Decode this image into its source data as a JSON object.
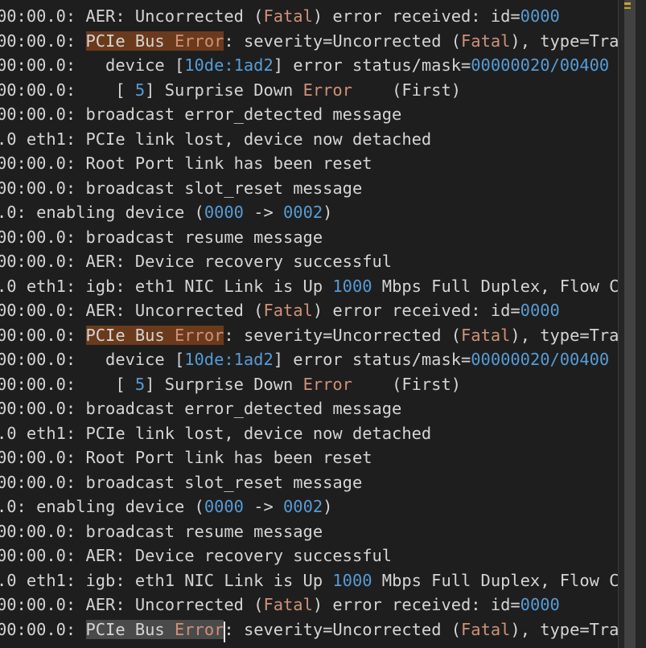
{
  "colors": {
    "background": "#1e1e1e",
    "text": "#d4d4d4",
    "number": "#569cd6",
    "error_word": "#ce9178",
    "search_highlight": "#6b3a1c",
    "current_match_highlight": "#4a4a4a",
    "overview_ruler_mark": "#c9a227"
  },
  "editor": {
    "lines": [
      [
        {
          "t": "00:00.0: AER: Uncorrected ("
        },
        {
          "t": "Fatal",
          "c": "err"
        },
        {
          "t": ") error received: id="
        },
        {
          "t": "0000",
          "c": "num"
        }
      ],
      [
        {
          "t": "00:00.0: "
        },
        {
          "t": "PCIe Bus ",
          "c": "hl"
        },
        {
          "t": "Error",
          "c": "err hl"
        },
        {
          "t": ": severity=Uncorrected ("
        },
        {
          "t": "Fatal",
          "c": "err"
        },
        {
          "t": "), type=Tra"
        }
      ],
      [
        {
          "t": "00:00.0:   device ["
        },
        {
          "t": "10de:1ad2",
          "c": "num"
        },
        {
          "t": "] error status/mask="
        },
        {
          "t": "00000020/00400",
          "c": "num"
        }
      ],
      [
        {
          "t": "00:00.0:    [ "
        },
        {
          "t": "5",
          "c": "num"
        },
        {
          "t": "] Surprise Down "
        },
        {
          "t": "Error",
          "c": "err"
        },
        {
          "t": "    (First)"
        }
      ],
      [
        {
          "t": "00:00.0: broadcast error_detected message"
        }
      ],
      [
        {
          "t": ".0 eth1: PCIe link lost, device now detached"
        }
      ],
      [
        {
          "t": "00:00.0: Root Port link has been reset"
        }
      ],
      [
        {
          "t": "00:00.0: broadcast slot_reset message"
        }
      ],
      [
        {
          "t": ".0: enabling device ("
        },
        {
          "t": "0000",
          "c": "num"
        },
        {
          "t": " -> "
        },
        {
          "t": "0002",
          "c": "num"
        },
        {
          "t": ")"
        }
      ],
      [
        {
          "t": "00:00.0: broadcast resume message"
        }
      ],
      [
        {
          "t": "00:00.0: AER: Device recovery successful"
        }
      ],
      [
        {
          "t": ".0 eth1: igb: eth1 NIC Link is Up "
        },
        {
          "t": "1000",
          "c": "num"
        },
        {
          "t": " Mbps Full Duplex, Flow C"
        }
      ],
      [
        {
          "t": "00:00.0: AER: Uncorrected ("
        },
        {
          "t": "Fatal",
          "c": "err"
        },
        {
          "t": ") error received: id="
        },
        {
          "t": "0000",
          "c": "num"
        }
      ],
      [
        {
          "t": "00:00.0: "
        },
        {
          "t": "PCIe Bus ",
          "c": "hl"
        },
        {
          "t": "Error",
          "c": "err hl"
        },
        {
          "t": ": severity=Uncorrected ("
        },
        {
          "t": "Fatal",
          "c": "err"
        },
        {
          "t": "), type=Tra"
        }
      ],
      [
        {
          "t": "00:00.0:   device ["
        },
        {
          "t": "10de:1ad2",
          "c": "num"
        },
        {
          "t": "] error status/mask="
        },
        {
          "t": "00000020/00400",
          "c": "num"
        }
      ],
      [
        {
          "t": "00:00.0:    [ "
        },
        {
          "t": "5",
          "c": "num"
        },
        {
          "t": "] Surprise Down "
        },
        {
          "t": "Error",
          "c": "err"
        },
        {
          "t": "    (First)"
        }
      ],
      [
        {
          "t": "00:00.0: broadcast error_detected message"
        }
      ],
      [
        {
          "t": ".0 eth1: PCIe link lost, device now detached"
        }
      ],
      [
        {
          "t": "00:00.0: Root Port link has been reset"
        }
      ],
      [
        {
          "t": "00:00.0: broadcast slot_reset message"
        }
      ],
      [
        {
          "t": ".0: enabling device ("
        },
        {
          "t": "0000",
          "c": "num"
        },
        {
          "t": " -> "
        },
        {
          "t": "0002",
          "c": "num"
        },
        {
          "t": ")"
        }
      ],
      [
        {
          "t": "00:00.0: broadcast resume message"
        }
      ],
      [
        {
          "t": "00:00.0: AER: Device recovery successful"
        }
      ],
      [
        {
          "t": ".0 eth1: igb: eth1 NIC Link is Up "
        },
        {
          "t": "1000",
          "c": "num"
        },
        {
          "t": " Mbps Full Duplex, Flow C"
        }
      ],
      [
        {
          "t": "00:00.0: AER: Uncorrected ("
        },
        {
          "t": "Fatal",
          "c": "err"
        },
        {
          "t": ") error received: id="
        },
        {
          "t": "0000",
          "c": "num"
        }
      ],
      [
        {
          "t": "00:00.0: "
        },
        {
          "t": "PCIe Bus ",
          "c": "hl cur"
        },
        {
          "t": "Error",
          "c": "err hl cur"
        },
        {
          "t": ": severity=Uncorrected ("
        },
        {
          "t": "Fatal",
          "c": "err"
        },
        {
          "t": "), type=Tra"
        }
      ]
    ]
  }
}
